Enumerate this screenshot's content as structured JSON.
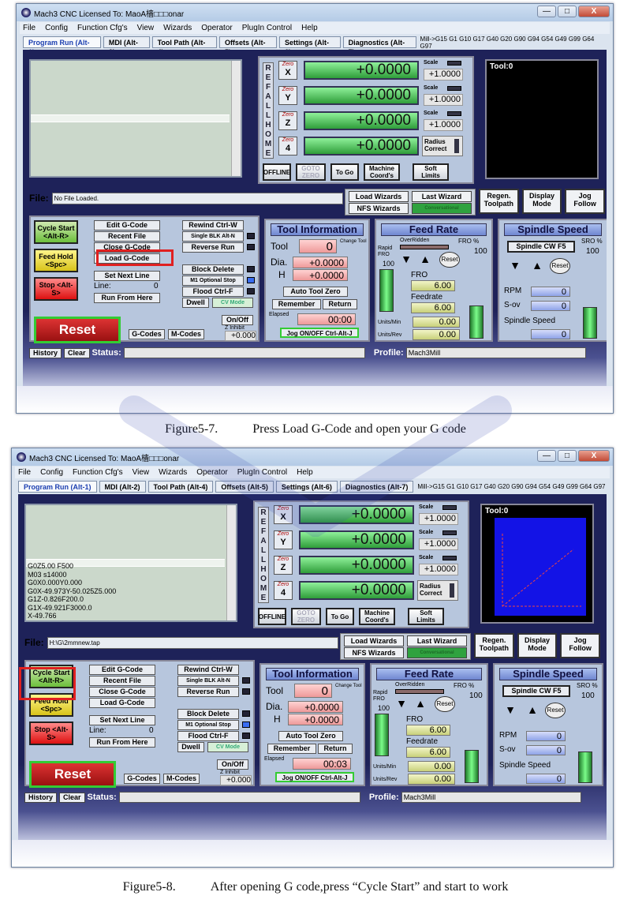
{
  "window": {
    "title": "Mach3 CNC  Licensed To: MaoA樯□□□onar",
    "minimize": "—",
    "maximize": "□",
    "close": "X"
  },
  "menu": [
    "File",
    "Config",
    "Function Cfg's",
    "View",
    "Wizards",
    "Operator",
    "PlugIn Control",
    "Help"
  ],
  "tabs": [
    "Program Run (Alt-1)",
    "MDI (Alt-2)",
    "Tool Path (Alt-4)",
    "Offsets (Alt-5)",
    "Settings (Alt-6)",
    "Diagnostics (Alt-7)"
  ],
  "gcode_modal": "Mill->G15  G1 G10 G17 G40 G20 G90 G94 G54 G49 G99 G64 G97",
  "ref_all_home": [
    "R",
    "E",
    "F",
    "A",
    "L",
    "L",
    "H",
    "O",
    "M",
    "E"
  ],
  "axes": [
    {
      "zero_label": "Zero",
      "axis": "X",
      "value": "+0.0000",
      "scale_label": "Scale",
      "scale": "+1.0000"
    },
    {
      "zero_label": "Zero",
      "axis": "Y",
      "value": "+0.0000",
      "scale_label": "Scale",
      "scale": "+1.0000"
    },
    {
      "zero_label": "Zero",
      "axis": "Z",
      "value": "+0.0000",
      "scale_label": "Scale",
      "scale": "+1.0000"
    },
    {
      "zero_label": "Zero",
      "axis": "4",
      "value": "+0.0000",
      "radius_label": "Radius Correct"
    }
  ],
  "axis_buttons": [
    "OFFLINE",
    "GOTO ZERO",
    "To Go",
    "Machine Coord's",
    "Soft Limits"
  ],
  "tool_display": "Tool:0",
  "file_label": "File:",
  "wizards": {
    "load": "Load Wizards",
    "last": "Last Wizard",
    "nfs": "NFS Wizards",
    "conv": "Conversational"
  },
  "view_buttons": [
    "Regen. Toolpath",
    "Display Mode",
    "Jog Follow"
  ],
  "controls": {
    "cycle_start": "Cycle Start <Alt-R>",
    "feed_hold": "Feed Hold <Spc>",
    "stop": "Stop <Alt-S>",
    "edit": "Edit G-Code",
    "recent": "Recent File",
    "close": "Close G-Code",
    "load": "Load G-Code",
    "set_next": "Set Next Line",
    "line_label": "Line:",
    "line_value": "0",
    "run_from": "Run From Here",
    "rewind": "Rewind Ctrl-W",
    "single_blk": "Single BLK Alt-N",
    "reverse": "Reverse Run",
    "block_delete": "Block Delete",
    "m1": "M1 Optional Stop",
    "flood": "Flood Ctrl-F",
    "dwell": "Dwell",
    "cv_mode": "CV Mode",
    "reset": "Reset",
    "on_off": "On/Off",
    "z_inhibit": "Z Inhibit",
    "z_value": "+0.000",
    "gcodes": "G-Codes",
    "mcodes": "M-Codes"
  },
  "tool_info": {
    "title": "Tool Information",
    "tool_label": "Tool",
    "tool_value": "0",
    "change": "Change Tool",
    "dia_label": "Dia.",
    "dia_value": "+0.0000",
    "h_label": "H",
    "h_value": "+0.0000",
    "auto_zero": "Auto Tool Zero",
    "remember": "Remember",
    "return": "Return",
    "elapsed_label": "Elapsed",
    "jog": "Jog ON/OFF Ctrl-Alt-J"
  },
  "feed_rate": {
    "title": "Feed Rate",
    "overridden": "OverRidden",
    "fro_pct": "FRO %",
    "fro_pct_value": "100",
    "rapid_fro": "Rapid FRO",
    "rapid_value": "100",
    "reset": "Reset",
    "fro": "FRO",
    "fro_value": "6.00",
    "feedrate": "Feedrate",
    "feedrate_value": "6.00",
    "units_min": "Units/Min",
    "units_min_value": "0.00",
    "units_rev": "Units/Rev",
    "units_rev_value": "0.00"
  },
  "spindle": {
    "title": "Spindle Speed",
    "cw": "Spindle CW F5",
    "sro": "SRO %",
    "sro_value": "100",
    "reset": "Reset",
    "rpm": "RPM",
    "rpm_value": "0",
    "sov": "S-ov",
    "sov_value": "0",
    "speed": "Spindle Speed",
    "speed_value": "0"
  },
  "statusbar": {
    "history": "History",
    "clear": "Clear",
    "status": "Status:",
    "profile": "Profile:",
    "profile_value": "Mach3Mill"
  },
  "shot1": {
    "file": "No File Loaded.",
    "elapsed": "00:00",
    "caption_num": "Figure5-7.",
    "caption": "Press Load G-Code and open your G code"
  },
  "shot2": {
    "file": "H:\\G\\2mmnew.tap",
    "elapsed": "00:03",
    "gcode_lines": [
      "G0Z5.00 F500",
      "M03 s14000",
      "G0X0.000Y0.000",
      "G0X-49.973Y-50.025Z5.000",
      "G1Z-0.826F200.0",
      "G1X-49.921F3000.0",
      "X-49.766",
      "X-49.714Z-0.848"
    ],
    "caption_num": "Figure5-8.",
    "caption": "After opening G code,press “Cycle Start” and start to work"
  }
}
